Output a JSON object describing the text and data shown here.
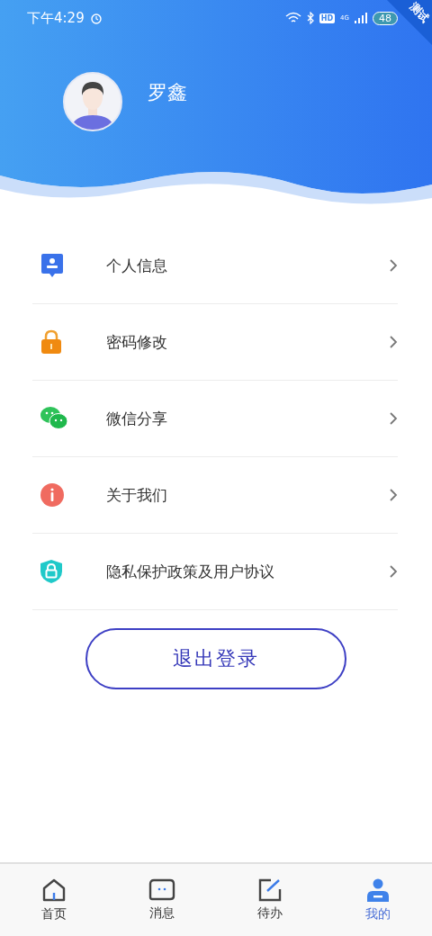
{
  "status_bar": {
    "time": "下午4:29",
    "hd": "HD",
    "network": "4G",
    "battery": "48",
    "ribbon": "测试"
  },
  "profile": {
    "name": "罗鑫"
  },
  "menu": [
    {
      "label": "个人信息"
    },
    {
      "label": "密码修改"
    },
    {
      "label": "微信分享"
    },
    {
      "label": "关于我们"
    },
    {
      "label": "隐私保护政策及用户协议"
    }
  ],
  "logout_button": "退出登录",
  "tabs": [
    {
      "label": "首页",
      "selected": false
    },
    {
      "label": "消息",
      "selected": false
    },
    {
      "label": "待办",
      "selected": false
    },
    {
      "label": "我的",
      "selected": true
    }
  ]
}
